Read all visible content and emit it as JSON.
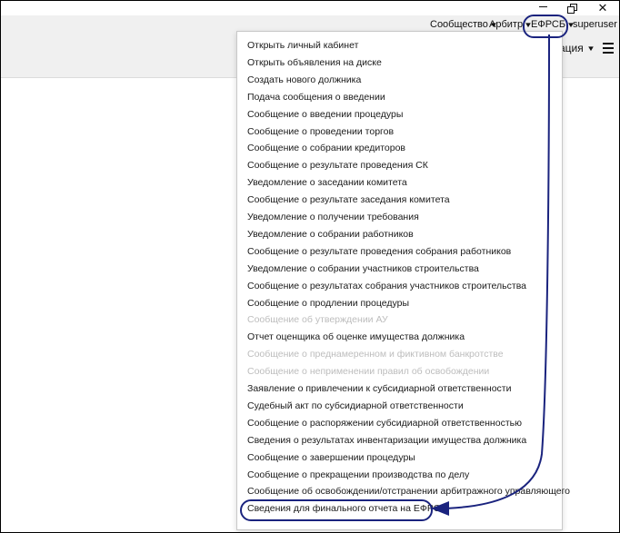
{
  "window": {
    "minimize_icon": "minimize-icon",
    "maximize_icon": "restore-icon",
    "close_glyph": "✕"
  },
  "topnav": {
    "community": "Сообщество",
    "arbiter": "Арбитр",
    "efrsb": "ЕФРСБ",
    "user": "superuser"
  },
  "secondbar": {
    "button_partial": "ация"
  },
  "menu": {
    "items": [
      {
        "label": "Открыть личный кабинет",
        "disabled": false
      },
      {
        "label": "Открыть объявления на диске",
        "disabled": false
      },
      {
        "label": "Создать нового должника",
        "disabled": false
      },
      {
        "label": "Подача сообщения о введении",
        "disabled": false
      },
      {
        "label": "Сообщение о введении процедуры",
        "disabled": false
      },
      {
        "label": "Сообщение о проведении торгов",
        "disabled": false
      },
      {
        "label": "Сообщение о собрании кредиторов",
        "disabled": false
      },
      {
        "label": "Сообщение о результате проведения СК",
        "disabled": false
      },
      {
        "label": "Уведомление о заседании комитета",
        "disabled": false
      },
      {
        "label": "Сообщение о результате заседания комитета",
        "disabled": false
      },
      {
        "label": "Уведомление о получении требования",
        "disabled": false
      },
      {
        "label": "Уведомление о собрании работников",
        "disabled": false
      },
      {
        "label": "Сообщение о результате проведения собрания работников",
        "disabled": false
      },
      {
        "label": "Уведомление о собрании участников строительства",
        "disabled": false
      },
      {
        "label": "Сообщение о результатах собрания участников строительства",
        "disabled": false
      },
      {
        "label": "Сообщение о продлении процедуры",
        "disabled": false
      },
      {
        "label": "Сообщение об утверждении АУ",
        "disabled": true
      },
      {
        "label": "Отчет оценщика об оценке имущества должника",
        "disabled": false
      },
      {
        "label": "Сообщение о преднамеренном и фиктивном банкротстве",
        "disabled": true
      },
      {
        "label": "Сообщение о неприменении правил об освобождении",
        "disabled": true
      },
      {
        "label": "Заявление о привлечении к субсидиарной ответственности",
        "disabled": false
      },
      {
        "label": "Судебный акт по субсидиарной ответственности",
        "disabled": false
      },
      {
        "label": "Сообщение о распоряжении субсидиарной ответственностью",
        "disabled": false
      },
      {
        "label": "Сведения о результатах инвентаризации имущества должника",
        "disabled": false
      },
      {
        "label": "Сообщение о завершении процедуры",
        "disabled": false
      },
      {
        "label": "Сообщение о прекращении производства по делу",
        "disabled": false
      },
      {
        "label": "Сообщение об освобождении/отстранении арбитражного управляющего",
        "disabled": false
      },
      {
        "label": "Сведения для финального отчета на ЕФРСБ",
        "disabled": false
      }
    ]
  },
  "colors": {
    "annotation": "#1a237e",
    "disabled_text": "#bdbdbd",
    "bar_bg": "#f0f0f0"
  }
}
